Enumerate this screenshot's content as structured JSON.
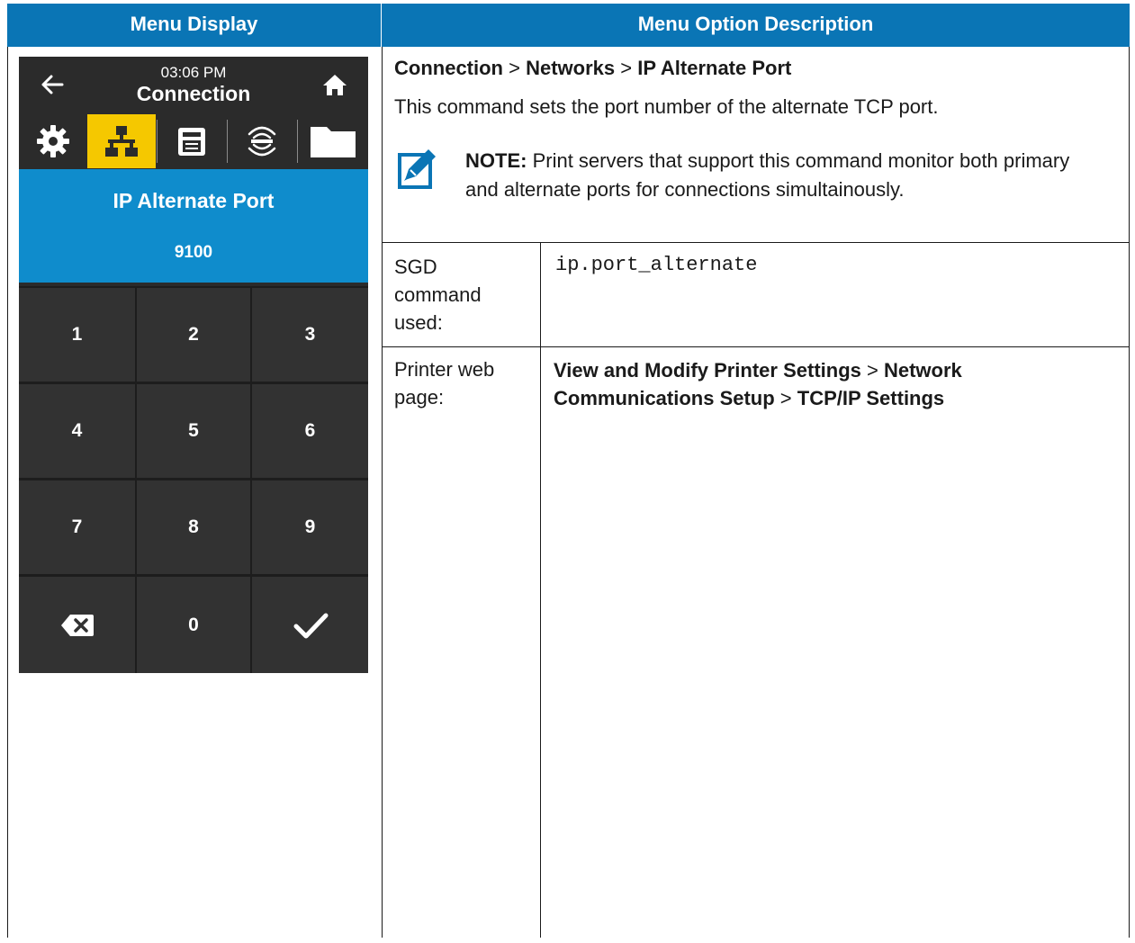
{
  "table": {
    "header_left": "Menu Display",
    "header_right": "Menu Option Description"
  },
  "device": {
    "time": "03:06 PM",
    "title": "Connection",
    "tabs": [
      {
        "icon": "gear-icon",
        "active": false
      },
      {
        "icon": "network-icon",
        "active": true
      },
      {
        "icon": "printer-icon",
        "active": false
      },
      {
        "icon": "rfid-icon",
        "active": false
      },
      {
        "icon": "folder-icon",
        "active": false
      }
    ],
    "field_label": "IP Alternate Port",
    "field_value": "9100",
    "keys": [
      "1",
      "2",
      "3",
      "4",
      "5",
      "6",
      "7",
      "8",
      "9",
      "0"
    ],
    "colors": {
      "accent_yellow": "#f5c800",
      "panel_blue": "#0f8ccc",
      "dark": "#2b2b2b"
    }
  },
  "description": {
    "breadcrumb": {
      "part1": "Connection",
      "sep1": " > ",
      "part2": "Networks",
      "sep2": " > ",
      "part3": "IP Alternate Port"
    },
    "text": "This command sets the port number of the alternate TCP port.",
    "note_label": "NOTE:",
    "note_text": " Print servers that support this command monitor both primary and alternate ports for connections simultainously."
  },
  "rows": {
    "sgd_label": "SGD command used:",
    "sgd_value": "ip.port_alternate",
    "web_label": "Printer web page:",
    "web_path": {
      "part1": "View and Modify Printer Settings",
      "sep1": " > ",
      "part2": "Network Communications Setup",
      "sep2": " > ",
      "part3": "TCP/IP Settings"
    }
  },
  "colors": {
    "header_blue": "#0a75b5"
  }
}
